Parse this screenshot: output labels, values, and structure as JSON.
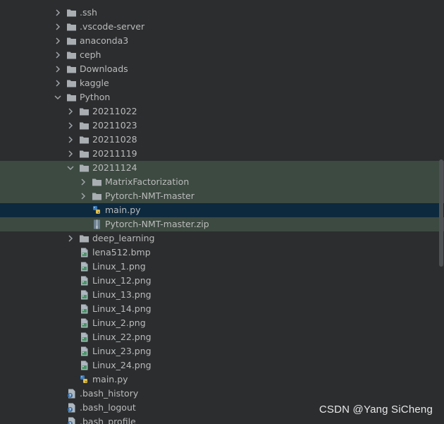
{
  "tree": [
    {
      "label": ".ssh",
      "depth": 0,
      "kind": "folder",
      "state": "collapsed"
    },
    {
      "label": ".vscode-server",
      "depth": 0,
      "kind": "folder",
      "state": "collapsed"
    },
    {
      "label": "anaconda3",
      "depth": 0,
      "kind": "folder",
      "state": "collapsed"
    },
    {
      "label": "ceph",
      "depth": 0,
      "kind": "folder",
      "state": "collapsed"
    },
    {
      "label": "Downloads",
      "depth": 0,
      "kind": "folder",
      "state": "collapsed"
    },
    {
      "label": "kaggle",
      "depth": 0,
      "kind": "folder",
      "state": "collapsed"
    },
    {
      "label": "Python",
      "depth": 0,
      "kind": "folder",
      "state": "expanded"
    },
    {
      "label": "20211022",
      "depth": 1,
      "kind": "folder",
      "state": "collapsed"
    },
    {
      "label": "20211023",
      "depth": 1,
      "kind": "folder",
      "state": "collapsed"
    },
    {
      "label": "20211028",
      "depth": 1,
      "kind": "folder",
      "state": "collapsed"
    },
    {
      "label": "20211119",
      "depth": 1,
      "kind": "folder",
      "state": "collapsed"
    },
    {
      "label": "20211124",
      "depth": 1,
      "kind": "folder",
      "state": "expanded",
      "highlight": "group"
    },
    {
      "label": "MatrixFactorization",
      "depth": 2,
      "kind": "folder",
      "state": "collapsed",
      "highlight": "group"
    },
    {
      "label": "Pytorch-NMT-master",
      "depth": 2,
      "kind": "folder",
      "state": "collapsed",
      "highlight": "group"
    },
    {
      "label": "main.py",
      "depth": 2,
      "kind": "python",
      "state": "none",
      "highlight": "selected"
    },
    {
      "label": "Pytorch-NMT-master.zip",
      "depth": 2,
      "kind": "zip",
      "state": "none",
      "highlight": "group"
    },
    {
      "label": "deep_learning",
      "depth": 1,
      "kind": "folder",
      "state": "collapsed"
    },
    {
      "label": "lena512.bmp",
      "depth": 1,
      "kind": "image",
      "state": "none"
    },
    {
      "label": "Linux_1.png",
      "depth": 1,
      "kind": "image",
      "state": "none"
    },
    {
      "label": "Linux_12.png",
      "depth": 1,
      "kind": "image",
      "state": "none"
    },
    {
      "label": "Linux_13.png",
      "depth": 1,
      "kind": "image",
      "state": "none"
    },
    {
      "label": "Linux_14.png",
      "depth": 1,
      "kind": "image",
      "state": "none"
    },
    {
      "label": "Linux_2.png",
      "depth": 1,
      "kind": "image",
      "state": "none"
    },
    {
      "label": "Linux_22.png",
      "depth": 1,
      "kind": "image",
      "state": "none"
    },
    {
      "label": "Linux_23.png",
      "depth": 1,
      "kind": "image",
      "state": "none"
    },
    {
      "label": "Linux_24.png",
      "depth": 1,
      "kind": "image",
      "state": "none"
    },
    {
      "label": "main.py",
      "depth": 1,
      "kind": "python",
      "state": "none"
    },
    {
      "label": ".bash_history",
      "depth": 0,
      "kind": "unknown",
      "state": "none"
    },
    {
      "label": ".bash_logout",
      "depth": 0,
      "kind": "unknown",
      "state": "none"
    },
    {
      "label": ".bash_profile",
      "depth": 0,
      "kind": "unknown",
      "state": "none"
    }
  ],
  "watermark": "CSDN @Yang SiCheng",
  "colors": {
    "background": "#2b2d2f",
    "text": "#bbbbbb",
    "folder": "#a9aeb3",
    "group_highlight": "#3c4a41",
    "selected_row": "#0d293e",
    "scrollbar": "#4e5154"
  },
  "icons": {
    "folder": "folder-icon",
    "python": "python-file-icon",
    "zip": "zip-archive-icon",
    "image": "image-file-icon",
    "unknown": "unknown-file-icon",
    "collapsed": "chevron-right-icon",
    "expanded": "chevron-down-icon"
  }
}
